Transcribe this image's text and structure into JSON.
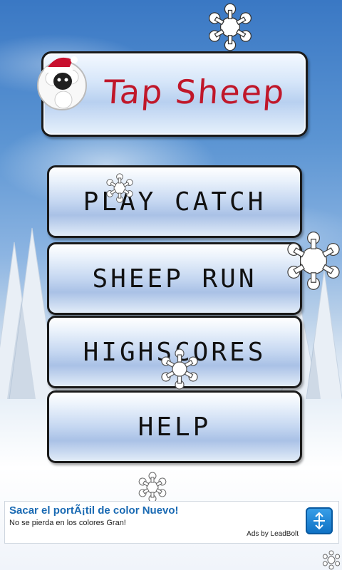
{
  "app": {
    "title": "Tap Sheep"
  },
  "menu": {
    "items": [
      {
        "label": "PLAY CATCH"
      },
      {
        "label": "SHEEP RUN"
      },
      {
        "label": "HIGHSCORES"
      },
      {
        "label": "HELP"
      }
    ]
  },
  "ad": {
    "title": "Sacar el portÃ¡til de color Nuevo!",
    "description": "No se pierda en los colores Gran!",
    "credit": "Ads by LeadBolt",
    "icon": "arrow-icon"
  },
  "colors": {
    "title_text": "#c0172a",
    "ad_title": "#1a6ab3"
  }
}
